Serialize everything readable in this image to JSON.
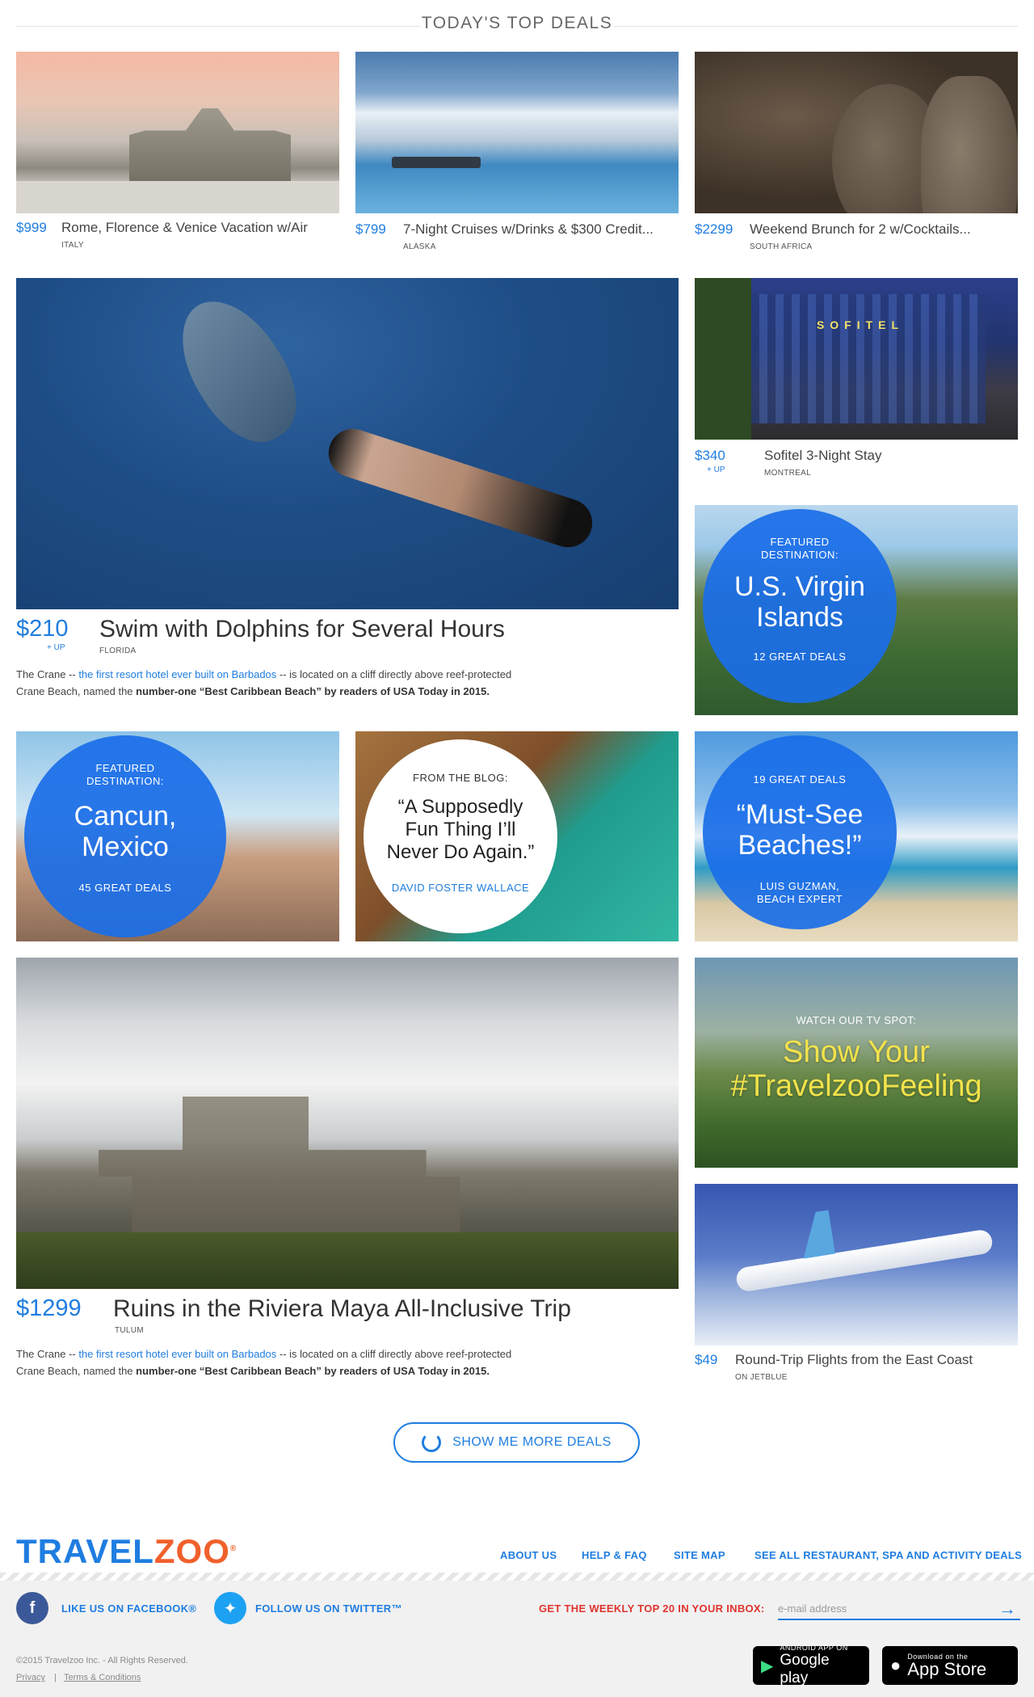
{
  "header": {
    "title": "TODAY'S TOP DEALS"
  },
  "deals": {
    "rome": {
      "price": "$999",
      "title": "Rome, Florence & Venice Vacation w/Air",
      "location": "ITALY"
    },
    "alaska": {
      "price": "$799",
      "title": "7-Night Cruises w/Drinks & $300 Credit...",
      "location": "ALASKA"
    },
    "brunch": {
      "price": "$2299",
      "title": "Weekend Brunch for 2 w/Cocktails...",
      "location": "SOUTH AFRICA"
    },
    "dolphins": {
      "price": "$210",
      "price_suffix": "+ UP",
      "title": "Swim with Dolphins for Several Hours",
      "location": "FLORIDA",
      "desc_pre": "The Crane -- ",
      "desc_link": "the first resort hotel ever built on Barbados",
      "desc_mid": " -- is located on a cliff directly above reef-protected",
      "desc_line2_pre": "Crane Beach, named the ",
      "desc_bold": "number-one “Best Caribbean Beach” by readers of USA Today in 2015."
    },
    "sofitel": {
      "price": "$340",
      "price_suffix": "+ UP",
      "title": "Sofitel 3-Night Stay",
      "location": "MONTREAL",
      "sign": "SOFITEL"
    },
    "ruins": {
      "price": "$1299",
      "title": "Ruins in the Riviera Maya All-Inclusive Trip",
      "location": "TULUM",
      "desc_pre": "The Crane -- ",
      "desc_link": "the first resort hotel ever built on Barbados",
      "desc_mid": " -- is located on a cliff directly above reef-protected",
      "desc_line2_pre": "Crane Beach, named the ",
      "desc_bold": "number-one “Best Caribbean Beach” by readers of USA Today in 2015."
    },
    "jetblue": {
      "price": "$49",
      "title": "Round-Trip Flights from the East Coast",
      "location": "ON JETBLUE"
    }
  },
  "featured": {
    "virgin": {
      "label_1": "FEATURED",
      "label_2": "DESTINATION:",
      "name_1": "U.S. Virgin",
      "name_2": "Islands",
      "count": "12 GREAT DEALS"
    },
    "cancun": {
      "label_1": "FEATURED",
      "label_2": "DESTINATION:",
      "name_1": "Cancun,",
      "name_2": "Mexico",
      "count": "45 GREAT DEALS"
    },
    "blog": {
      "label": "FROM THE BLOG:",
      "quote_1": "“A Supposedly",
      "quote_2": "Fun Thing I’ll",
      "quote_3": "Never Do Again.”",
      "author": "DAVID FOSTER WALLACE"
    },
    "beaches": {
      "count": "19 GREAT DEALS",
      "title_1": "“Must-See",
      "title_2": "Beaches!”",
      "author_1": "LUIS GUZMAN,",
      "author_2": "BEACH EXPERT"
    },
    "tv": {
      "label": "WATCH OUR TV SPOT:",
      "title_1": "Show Your",
      "title_2": "#TravelzooFeeling"
    }
  },
  "more_button": {
    "label": "SHOW ME MORE DEALS"
  },
  "footer": {
    "logo_travel": "TRAVEL",
    "logo_zoo": "ZOO",
    "logo_mark": "®",
    "nav": [
      "ABOUT US",
      "HELP & FAQ",
      "SITE MAP",
      "SEE ALL RESTAURANT, SPA AND ACTIVITY DEALS"
    ],
    "facebook": "LIKE US ON FACEBOOK®",
    "twitter": "FOLLOW US ON TWITTER™",
    "newsletter_label": "GET THE WEEKLY TOP 20 IN YOUR INBOX:",
    "email_placeholder": "e-mail address",
    "copyright": "©2015 Travelzoo Inc. - All Rights Reserved.",
    "privacy": "Privacy",
    "separator": "|",
    "terms": "Terms & Conditions",
    "google_small": "ANDROID APP ON",
    "google_big": "Google play",
    "apple_small": "Download on the",
    "apple_big": "App Store"
  },
  "colors": {
    "accent_blue": "#1f7de0",
    "circle_blue": "#1a6ee8",
    "brand_orange": "#f0602b",
    "newsletter_red": "#e0332d",
    "tv_yellow": "#f2e24b"
  }
}
